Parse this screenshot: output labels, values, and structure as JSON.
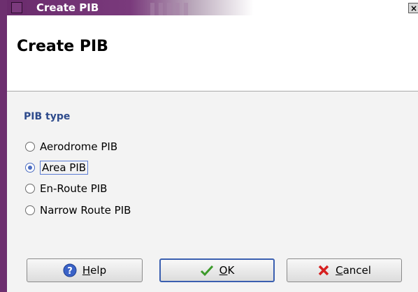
{
  "window": {
    "title": "Create PIB",
    "close_glyph": "×"
  },
  "header": {
    "title": "Create PIB"
  },
  "pib_type": {
    "label": "PIB type",
    "options": [
      {
        "label": "Aerodrome PIB",
        "checked": false
      },
      {
        "label": "Area PIB",
        "checked": true
      },
      {
        "label": "En-Route PIB",
        "checked": false
      },
      {
        "label": "Narrow Route PIB",
        "checked": false
      }
    ]
  },
  "buttons": {
    "help": {
      "mnemonic": "H",
      "rest": "elp",
      "icon": "help-icon"
    },
    "ok": {
      "mnemonic": "O",
      "rest": "K",
      "icon": "checkmark-icon"
    },
    "cancel": {
      "mnemonic": "C",
      "rest": "ancel",
      "icon": "cancel-x-icon"
    }
  }
}
